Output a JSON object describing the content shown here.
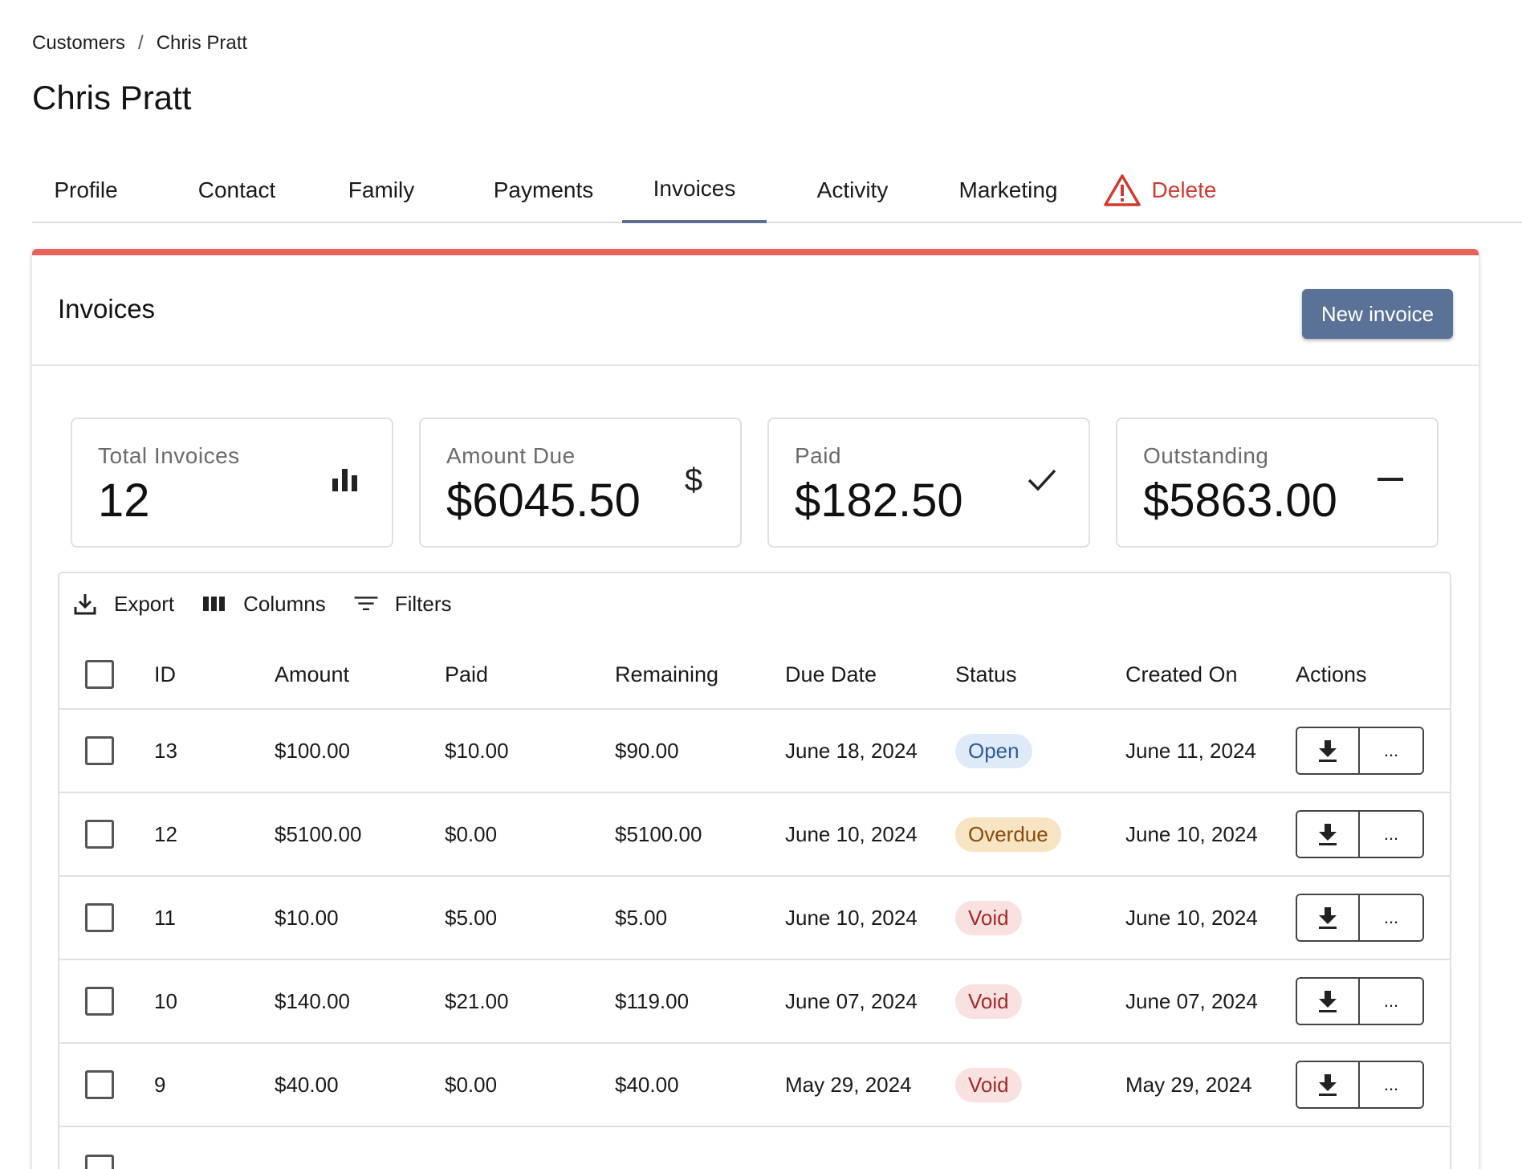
{
  "breadcrumb": {
    "parent": "Customers",
    "separator": "/",
    "current": "Chris Pratt"
  },
  "page_title": "Chris Pratt",
  "tabs": [
    {
      "label": "Profile"
    },
    {
      "label": "Contact"
    },
    {
      "label": "Family"
    },
    {
      "label": "Payments"
    },
    {
      "label": "Invoices",
      "active": true
    },
    {
      "label": "Activity"
    },
    {
      "label": "Marketing"
    },
    {
      "label": "Delete",
      "icon": "warning-icon"
    }
  ],
  "card": {
    "title": "Invoices",
    "new_button": "New invoice",
    "accent": "#e8635a"
  },
  "stats": [
    {
      "label": "Total Invoices",
      "value": "12",
      "icon": "bar-chart-icon"
    },
    {
      "label": "Amount Due",
      "value": "$6045.50",
      "icon": "dollar-icon"
    },
    {
      "label": "Paid",
      "value": "$182.50",
      "icon": "check-icon"
    },
    {
      "label": "Outstanding",
      "value": "$5863.00",
      "icon": "minus-icon"
    }
  ],
  "toolbar": {
    "export": "Export",
    "columns": "Columns",
    "filters": "Filters"
  },
  "table": {
    "columns": [
      "ID",
      "Amount",
      "Paid",
      "Remaining",
      "Due Date",
      "Status",
      "Created On",
      "Actions"
    ],
    "rows": [
      {
        "id": "13",
        "amount": "$100.00",
        "paid": "$10.00",
        "remaining": "$90.00",
        "due": "June 18, 2024",
        "status": "Open",
        "created": "June 11, 2024",
        "more": "..."
      },
      {
        "id": "12",
        "amount": "$5100.00",
        "paid": "$0.00",
        "remaining": "$5100.00",
        "due": "June 10, 2024",
        "status": "Overdue",
        "created": "June 10, 2024",
        "more": "..."
      },
      {
        "id": "11",
        "amount": "$10.00",
        "paid": "$5.00",
        "remaining": "$5.00",
        "due": "June 10, 2024",
        "status": "Void",
        "created": "June 10, 2024",
        "more": "..."
      },
      {
        "id": "10",
        "amount": "$140.00",
        "paid": "$21.00",
        "remaining": "$119.00",
        "due": "June 07, 2024",
        "status": "Void",
        "created": "June 07, 2024",
        "more": "..."
      },
      {
        "id": "9",
        "amount": "$40.00",
        "paid": "$0.00",
        "remaining": "$40.00",
        "due": "May 29, 2024",
        "status": "Void",
        "created": "May 29, 2024",
        "more": "..."
      }
    ]
  },
  "colors": {
    "primary": "#5b7297",
    "danger": "#cf3b32",
    "tab_indicator": "#5b6f93"
  }
}
